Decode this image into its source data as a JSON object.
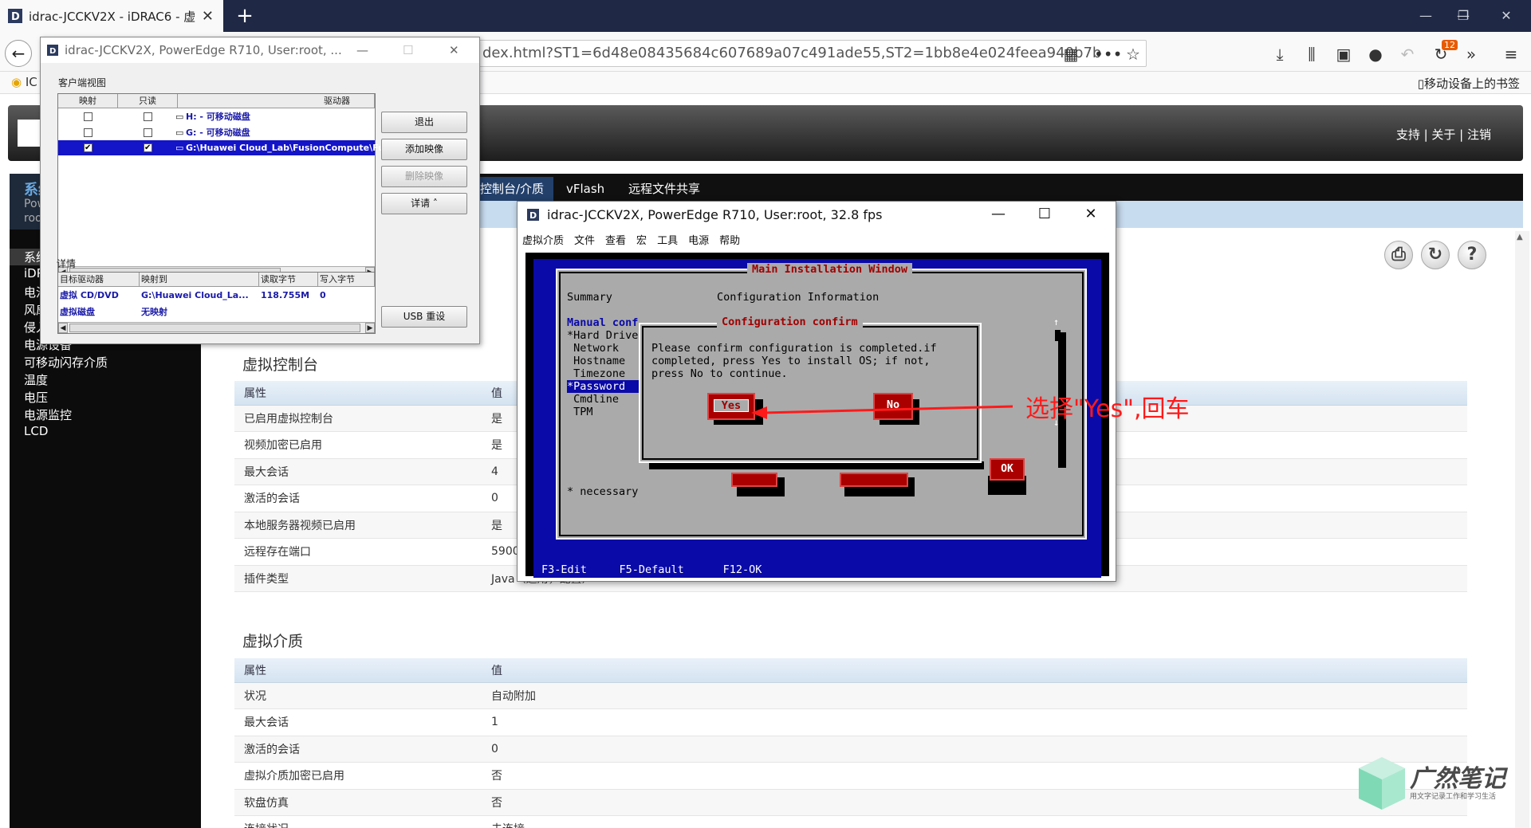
{
  "browser": {
    "tab_title": "idrac-JCCKV2X - iDRAC6 - 虚",
    "url": "dex.html?ST1=6d48e08435684c607689a07c491ade55,ST2=1bb8e4e024feea940b7b",
    "bookmark_left": "IC",
    "bookmark_right": "移动设备上的书签",
    "badge": "12"
  },
  "idrac": {
    "top_links": "支持  |  关于  |  注销",
    "left_title": "系统",
    "left_sub1": "Pow",
    "left_sub2": "roo",
    "sidebar": [
      "系统",
      "iDR",
      "电池",
      "风扇",
      "侵入",
      "电源设备",
      "可移动闪存介质",
      "温度",
      "电压",
      "电源监控",
      "LCD"
    ],
    "tabs": [
      "控制台/介质",
      "vFlash",
      "远程文件共享"
    ],
    "section1_title": "虚拟控制台",
    "section1_headers": [
      "属性",
      "值"
    ],
    "section1_rows": [
      [
        "已启用虚拟控制台",
        "是"
      ],
      [
        "视频加密已启用",
        "是"
      ],
      [
        "最大会话",
        "4"
      ],
      [
        "激活的会话",
        "0"
      ],
      [
        "本地服务器视频已启用",
        "是"
      ],
      [
        "远程存在端口",
        "5900"
      ],
      [
        "插件类型",
        "Java（通用，配置）"
      ]
    ],
    "section2_title": "虚拟介质",
    "section2_headers": [
      "属性",
      "值"
    ],
    "section2_rows": [
      [
        "状况",
        "自动附加"
      ],
      [
        "最大会话",
        "1"
      ],
      [
        "激活的会话",
        "0"
      ],
      [
        "虚拟介质加密已启用",
        "否"
      ],
      [
        "软盘仿真",
        "否"
      ],
      [
        "连接状况",
        "未连接"
      ]
    ]
  },
  "vm_dialog": {
    "title": "idrac-JCCKV2X, PowerEdge R710, User:root, ...",
    "client_view_label": "客户端视图",
    "list_headers": [
      "映射",
      "只读",
      "驱动器"
    ],
    "drives": [
      {
        "name": "H: - 可移动磁盘",
        "mapped": false,
        "readonly": false,
        "selected": false
      },
      {
        "name": "G: - 可移动磁盘",
        "mapped": false,
        "readonly": false,
        "selected": false
      },
      {
        "name": "G:\\Huawei Cloud_Lab\\FusionCompute\\Fu",
        "mapped": true,
        "readonly": true,
        "selected": true
      }
    ],
    "buttons": {
      "exit": "退出",
      "add_image": "添加映像",
      "remove_image": "删除映像",
      "details": "详请 ˄",
      "usb_reset": "USB 重设"
    },
    "details_label": "详情",
    "detail_headers": [
      "目标驱动器",
      "映射到",
      "读取字节",
      "写入字节"
    ],
    "detail_rows": [
      [
        "虚拟 CD/DVD",
        "G:\\Huawei Cloud_La...",
        "118.755M",
        "0"
      ],
      [
        "虚拟磁盘",
        "无映射",
        "",
        ""
      ]
    ]
  },
  "kvm": {
    "title": "idrac-JCCKV2X, PowerEdge R710, User:root, 32.8 fps",
    "menu": [
      "虚拟介质",
      "文件",
      "查看",
      "宏",
      "工具",
      "电源",
      "帮助"
    ],
    "screen": {
      "main_title": "Main Installation Window",
      "summary": "Summary",
      "config_info": "Configuration Information",
      "menu_items": [
        "Manual conf",
        "*Hard Drive",
        " Network",
        " Hostname",
        " Timezone",
        "*Password",
        " Cmdline",
        " TPM"
      ],
      "necessary": "* necessary",
      "ok": "OK",
      "confirm_title": "Configuration confirm",
      "confirm_lines": [
        "Please confirm configuration is completed.if",
        "completed, press Yes to install OS; if not,",
        "press No to continue."
      ],
      "yes": "Yes",
      "no": "No",
      "fkeys": "F3-Edit     F5-Default      F12-OK"
    }
  },
  "annotation": "选择\"Yes\",回车",
  "watermark": {
    "title": "广然笔记",
    "subtitle": "用文字记录工作和学习生活"
  }
}
